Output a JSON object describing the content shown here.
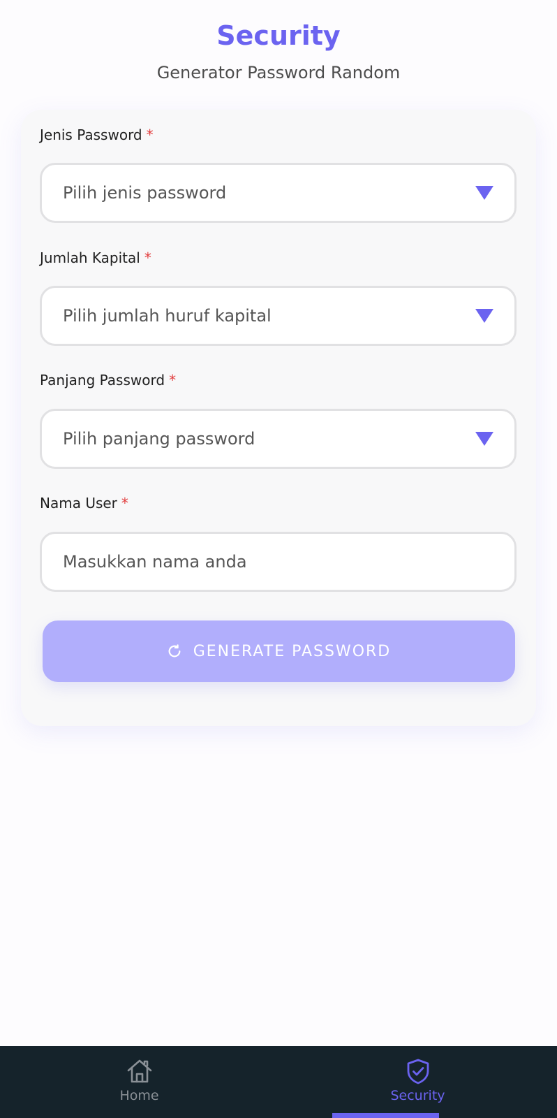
{
  "header": {
    "title": "Security",
    "subtitle": "Generator Password Random"
  },
  "form": {
    "required_mark": "*",
    "fields": [
      {
        "label": "Jenis Password",
        "placeholder": "Pilih jenis password",
        "type": "select"
      },
      {
        "label": "Jumlah Kapital",
        "placeholder": "Pilih jumlah huruf kapital",
        "type": "select"
      },
      {
        "label": "Panjang Password",
        "placeholder": "Pilih panjang password",
        "type": "select"
      },
      {
        "label": "Nama User",
        "placeholder": "Masukkan nama anda",
        "type": "text"
      }
    ],
    "generate_label": "GENERATE PASSWORD",
    "generate_icon": "refresh-icon"
  },
  "bottom_nav": {
    "items": [
      {
        "label": "Home",
        "icon": "home-icon",
        "active": false
      },
      {
        "label": "Security",
        "icon": "shield-check-icon",
        "active": true
      }
    ]
  },
  "colors": {
    "accent": "#6b63f0",
    "button_disabled": "#b1aefc",
    "required": "#e23b3b",
    "nav_background": "#15232b",
    "nav_inactive": "#8a9096"
  }
}
